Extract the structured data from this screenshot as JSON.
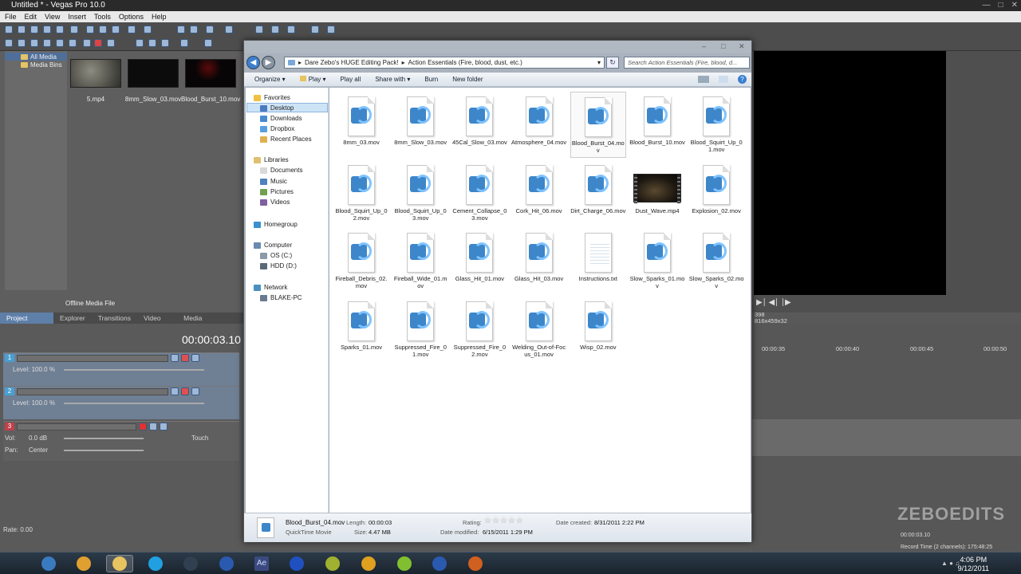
{
  "vegas": {
    "title": "Untitled * - Vegas Pro 10.0",
    "menu": [
      "File",
      "Edit",
      "View",
      "Insert",
      "Tools",
      "Options",
      "Help"
    ],
    "media_tree": [
      "All Media",
      "Media Bins"
    ],
    "thumbs": [
      {
        "label": "5.mp4",
        "color": "#6f6f66"
      },
      {
        "label": "8mm_Slow_03.mov",
        "color": "#0c0c0c"
      },
      {
        "label": "Blood_Burst_10.mov",
        "color": "#090606"
      }
    ],
    "offline_label": "Offline Media File",
    "tabs": [
      "Project Media",
      "Explorer",
      "Transitions",
      "Video FX",
      "Media Generators"
    ],
    "timecode": "00:00:03.10",
    "tracks": [
      {
        "num": "1",
        "level": "Level: 100.0 %",
        "color": "#4a9fd0"
      },
      {
        "num": "2",
        "level": "Level: 100.0 %",
        "color": "#4a9fd0"
      },
      {
        "num": "3",
        "vol": "Vol:",
        "vol_val": "0.0 dB",
        "pan": "Pan:",
        "pan_val": "Center",
        "touch": "Touch",
        "color": "#c0404a"
      }
    ],
    "rate": "Rate: 0.00",
    "ruler": [
      "00:00:35",
      "00:00:40",
      "00:00:45",
      "00:00:50"
    ],
    "preview_info": "816x459x32",
    "preview_num": "398",
    "record_time": "Record Time (2 channels): 175:48:25",
    "bottom_timecode": "00:00:03.10"
  },
  "explorer": {
    "path": [
      "Dare Zebo's HUGE Editing Pack!",
      "Action Essentials (Fire, blood, dust, etc.)"
    ],
    "search_placeholder": "Search Action Essentials (Fire, blood, d...",
    "commands": [
      "Organize ▾",
      "Play ▾",
      "Play all",
      "Share with ▾",
      "Burn",
      "New folder"
    ],
    "nav": [
      {
        "label": "Favorites",
        "icon": "favorites-star-icon",
        "color": "#f0c040",
        "indent": 0
      },
      {
        "label": "Desktop",
        "icon": "desktop-icon",
        "color": "#4a7ac0",
        "indent": 1,
        "selected": true
      },
      {
        "label": "Downloads",
        "icon": "downloads-folder-icon",
        "color": "#4a8ad0",
        "indent": 1
      },
      {
        "label": "Dropbox",
        "icon": "dropbox-folder-icon",
        "color": "#5aa0e0",
        "indent": 1
      },
      {
        "label": "Recent Places",
        "icon": "recent-places-icon",
        "color": "#e0b050",
        "indent": 1
      },
      {
        "label": "Libraries",
        "icon": "libraries-icon",
        "color": "#e0c070",
        "indent": 0
      },
      {
        "label": "Documents",
        "icon": "documents-icon",
        "color": "#d9d9d9",
        "indent": 1
      },
      {
        "label": "Music",
        "icon": "music-icon",
        "color": "#5080c0",
        "indent": 1
      },
      {
        "label": "Pictures",
        "icon": "pictures-icon",
        "color": "#70a050",
        "indent": 1
      },
      {
        "label": "Videos",
        "icon": "videos-icon",
        "color": "#8060a0",
        "indent": 1
      },
      {
        "label": "Homegroup",
        "icon": "homegroup-icon",
        "color": "#3a90d0",
        "indent": 0
      },
      {
        "label": "Computer",
        "icon": "computer-icon",
        "color": "#6a8ab0",
        "indent": 0
      },
      {
        "label": "OS (C:)",
        "icon": "drive-c-icon",
        "color": "#8a9aa8",
        "indent": 1
      },
      {
        "label": "HDD (D:)",
        "icon": "drive-d-icon",
        "color": "#5a6a78",
        "indent": 1
      },
      {
        "label": "Network",
        "icon": "network-icon",
        "color": "#4a90c0",
        "indent": 0
      },
      {
        "label": "BLAKE-PC",
        "icon": "pc-icon",
        "color": "#6a7a90",
        "indent": 1
      }
    ],
    "files": [
      "8mm_03.mov",
      "8mm_Slow_03.mov",
      "45Cal_Slow_03.mov",
      "Atmosphere_04.mov",
      "Blood_Burst_04.mov",
      "Blood_Burst_10.mov",
      "Blood_Squirt_Up_01.mov",
      "Blood_Squirt_Up_02.mov",
      "Blood_Squirt_Up_03.mov",
      "Cement_Collapse_03.mov",
      "Cork_Hit_06.mov",
      "Dirt_Charge_06.mov",
      "Dust_Wave.mp4",
      "Explosion_02.mov",
      "Fireball_Debris_02.mov",
      "Fireball_Wide_01.mov",
      "Glass_Hit_01.mov",
      "Glass_Hit_03.mov",
      "Instructions.txt",
      "Slow_Sparks_01.mov",
      "Slow_Sparks_02.mov",
      "Sparks_01.mov",
      "Suppressed_Fire_01.mov",
      "Suppressed_Fire_02.mov",
      "Welding_Out-of-Focus_01.mov",
      "Wisp_02.mov"
    ],
    "selected_file": "Blood_Burst_04.mov",
    "details": {
      "name": "Blood_Burst_04.mov",
      "type": "QuickTime Movie",
      "length_label": "Length:",
      "length": "00:00:03",
      "size_label": "Size:",
      "size": "4.47 MB",
      "rating_label": "Rating:",
      "rating_stars": 0,
      "date_modified_label": "Date modified:",
      "date_modified": "6/15/2011 1:29 PM",
      "date_created_label": "Date created:",
      "date_created": "8/31/2011 2:22 PM"
    }
  },
  "taskbar": {
    "apps": [
      {
        "name": "windows-start-icon",
        "color": "#3a7abf"
      },
      {
        "name": "chrome-icon",
        "color": "#e0a030"
      },
      {
        "name": "explorer-folder-icon",
        "color": "#e8c460",
        "active": true
      },
      {
        "name": "skype-icon",
        "color": "#20a0e0"
      },
      {
        "name": "terminal-icon",
        "color": "#304050"
      },
      {
        "name": "vegas-globe-icon",
        "color": "#2a5ab0"
      },
      {
        "name": "after-effects-icon",
        "color": "#3a4a80",
        "text": "Ae"
      },
      {
        "name": "firefox-icon",
        "color": "#2050c0"
      },
      {
        "name": "winamp-icon",
        "color": "#a0b030"
      },
      {
        "name": "user-badge-icon",
        "color": "#e0a020"
      },
      {
        "name": "spotify-icon",
        "color": "#80c030"
      },
      {
        "name": "word-icon",
        "color": "#2a5ab0"
      },
      {
        "name": "pumpkin-icon",
        "color": "#d06020"
      }
    ],
    "time": "4:06 PM",
    "date": "9/12/2011"
  },
  "watermark": "ZEBOEDITS"
}
